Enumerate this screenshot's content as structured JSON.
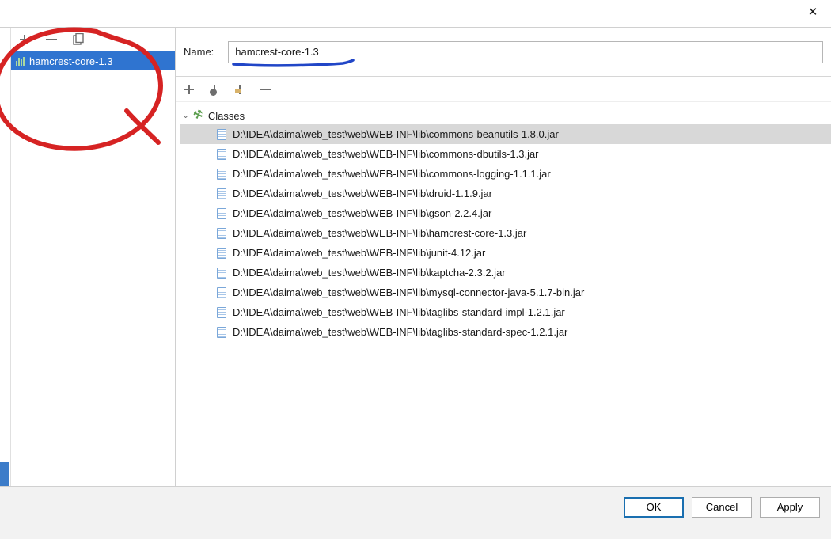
{
  "name_label": "Name:",
  "name_value": "hamcrest-core-1.3",
  "sidebar": {
    "items": [
      "hamcrest-core-1.3"
    ]
  },
  "tree": {
    "root_label": "Classes",
    "files": [
      "D:\\IDEA\\daima\\web_test\\web\\WEB-INF\\lib\\commons-beanutils-1.8.0.jar",
      "D:\\IDEA\\daima\\web_test\\web\\WEB-INF\\lib\\commons-dbutils-1.3.jar",
      "D:\\IDEA\\daima\\web_test\\web\\WEB-INF\\lib\\commons-logging-1.1.1.jar",
      "D:\\IDEA\\daima\\web_test\\web\\WEB-INF\\lib\\druid-1.1.9.jar",
      "D:\\IDEA\\daima\\web_test\\web\\WEB-INF\\lib\\gson-2.2.4.jar",
      "D:\\IDEA\\daima\\web_test\\web\\WEB-INF\\lib\\hamcrest-core-1.3.jar",
      "D:\\IDEA\\daima\\web_test\\web\\WEB-INF\\lib\\junit-4.12.jar",
      "D:\\IDEA\\daima\\web_test\\web\\WEB-INF\\lib\\kaptcha-2.3.2.jar",
      "D:\\IDEA\\daima\\web_test\\web\\WEB-INF\\lib\\mysql-connector-java-5.1.7-bin.jar",
      "D:\\IDEA\\daima\\web_test\\web\\WEB-INF\\lib\\taglibs-standard-impl-1.2.1.jar",
      "D:\\IDEA\\daima\\web_test\\web\\WEB-INF\\lib\\taglibs-standard-spec-1.2.1.jar"
    ],
    "selected_index": 0
  },
  "buttons": {
    "ok": "OK",
    "cancel": "Cancel",
    "apply": "Apply"
  }
}
